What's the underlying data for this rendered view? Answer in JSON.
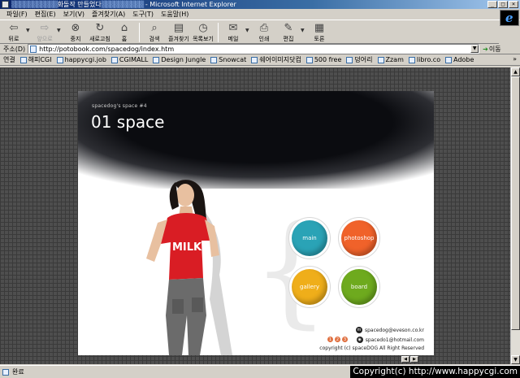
{
  "window": {
    "title_dots_left": "▒▒▒▒▒▒▒▒▒▒▒",
    "title_main": "화돌작 만들었다",
    "title_dots_right": "▒▒▒▒▒▒▒▒▒▒",
    "title_app": " - Microsoft Internet Explorer",
    "btn_min": "_",
    "btn_max": "□",
    "btn_close": "×"
  },
  "menu": [
    "파일(F)",
    "편집(E)",
    "보기(V)",
    "즐겨찾기(A)",
    "도구(T)",
    "도움말(H)"
  ],
  "toolbar": {
    "back": "뒤로",
    "forward": "앞으로",
    "stop": "중지",
    "refresh": "새로고침",
    "home": "홈",
    "search": "검색",
    "favorites": "즐겨찾기",
    "history": "목록보기",
    "mail": "메일",
    "print": "인쇄",
    "edit": "편집",
    "discuss": "토론"
  },
  "address": {
    "label": "주소(D)",
    "url": "http://potobook.com/spacedog/index.htm",
    "go": "이동"
  },
  "links": {
    "label": "연결",
    "items": [
      "해피CGI",
      "happycgi.job",
      "CGIMALL",
      "Design Jungle",
      "Snowcat",
      "쉐어이미지닷컴",
      "500 free",
      "덩어리",
      "Zzam",
      "libro.co",
      "Adobe"
    ],
    "more": "»"
  },
  "site": {
    "small_title": "spacedog's space #4",
    "big_title": "01 space",
    "brace": "{",
    "shirt_text": "MILK",
    "nav": {
      "main": "main",
      "photoshop": "photoshop",
      "gallery": "gallery",
      "board": "board"
    },
    "email1": "spacedog@eveson.co.kr",
    "email2": "spacedo1@hotmail.com",
    "copyright": "copyright (c) spaceDOG All Right Reserved",
    "pages": [
      "1",
      "2",
      "3"
    ]
  },
  "status": {
    "text": "완료"
  },
  "watermark": "Copyright(c) http://www.happycgi.com",
  "colors": {
    "main": "#2aa3b6",
    "photoshop": "#f0622a",
    "gallery": "#efae1a",
    "board": "#6eaa1e"
  }
}
